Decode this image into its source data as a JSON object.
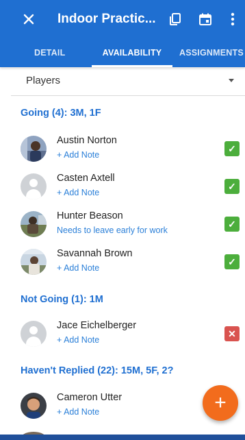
{
  "appbar": {
    "title": "Indoor Practic...",
    "close_icon": "close-icon",
    "actions": [
      "copy-icon",
      "calendar-icon",
      "more-vert-icon"
    ],
    "color": "#1f6fd1"
  },
  "tabs": [
    {
      "label": "DETAIL",
      "selected": false
    },
    {
      "label": "AVAILABILITY",
      "selected": true
    },
    {
      "label": "ASSIGNMENTS",
      "selected": false
    }
  ],
  "filter": {
    "selected": "Players"
  },
  "sections": {
    "going": {
      "header": "Going (4): 3M, 1F",
      "players": [
        {
          "name": "Austin Norton",
          "note": "+ Add Note",
          "status": "✓",
          "avatar": "photo"
        },
        {
          "name": "Casten Axtell",
          "note": "+ Add Note",
          "status": "✓",
          "avatar": "placeholder"
        },
        {
          "name": "Hunter Beason",
          "note": "Needs to leave early for work",
          "status": "✓",
          "avatar": "photo"
        },
        {
          "name": "Savannah Brown",
          "note": "+ Add Note",
          "status": "✓",
          "avatar": "photo"
        }
      ]
    },
    "not_going": {
      "header": "Not Going (1): 1M",
      "players": [
        {
          "name": "Jace Eichelberger",
          "note": "+ Add Note",
          "status": "✕",
          "avatar": "placeholder"
        }
      ]
    },
    "no_reply": {
      "header": "Haven't Replied (22): 15M, 5F, 2?",
      "players": [
        {
          "name": "Cameron Utter",
          "note": "+ Add Note",
          "avatar": "photo"
        }
      ]
    }
  },
  "fab": {
    "label": "+",
    "color": "#f26c1d"
  },
  "colors": {
    "going": "#4cae3c",
    "not_going": "#d9534f",
    "accent": "#1f6fd1"
  }
}
